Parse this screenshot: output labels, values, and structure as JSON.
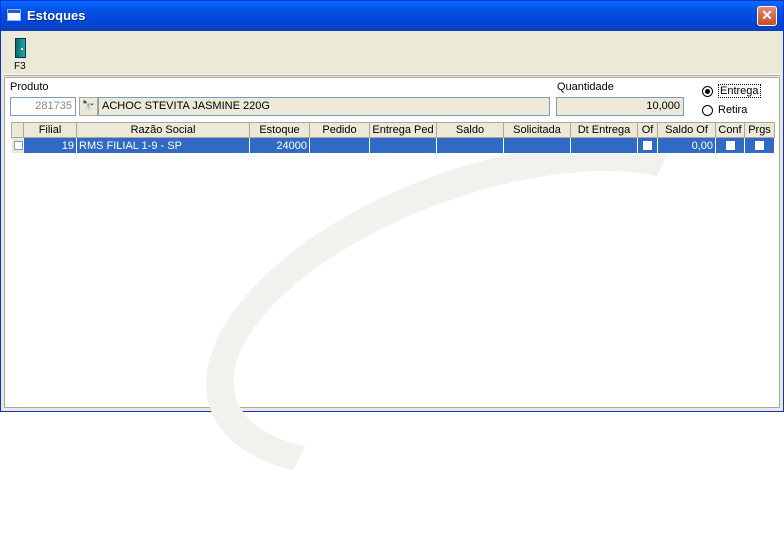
{
  "window": {
    "title": "Estoques"
  },
  "toolbar": {
    "exit_label": "F3"
  },
  "form": {
    "produto_label": "Produto",
    "produto_code": "281735",
    "produto_desc": "ACHOC STEVITA JASMINE 220G",
    "quantidade_label": "Quantidade",
    "quantidade_value": "10,000",
    "radio_entrega": "Entrega",
    "radio_retira": "Retira",
    "selected_option": "Entrega"
  },
  "grid": {
    "columns": [
      "Filial",
      "Razão Social",
      "Estoque",
      "Pedido",
      "Entrega Ped",
      "Saldo",
      "Solicitada",
      "Dt Entrega",
      "Of",
      "Saldo Of",
      "Conf",
      "Prgs"
    ],
    "rows": [
      {
        "filial": "19",
        "razao": "RMS FILIAL 1-9 - SP",
        "estoque": "24000",
        "pedido": "",
        "entrega_ped": "",
        "saldo": "",
        "solicitada": "",
        "dt_entrega": "",
        "saldo_of": "0,00"
      }
    ]
  }
}
